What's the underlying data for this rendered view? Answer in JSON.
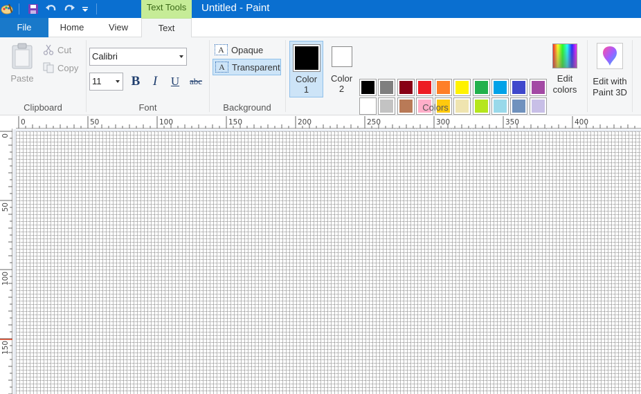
{
  "window": {
    "title": "Untitled - Paint",
    "context_tab_group": "Text Tools"
  },
  "tabs": {
    "file": "File",
    "home": "Home",
    "view": "View",
    "text": "Text"
  },
  "clipboard": {
    "paste": "Paste",
    "cut": "Cut",
    "copy": "Copy",
    "group_label": "Clipboard"
  },
  "font": {
    "family": "Calibri",
    "size": "11",
    "bold": "B",
    "italic": "I",
    "underline": "U",
    "strikethrough": "abc",
    "group_label": "Font"
  },
  "background": {
    "opaque": "Opaque",
    "transparent": "Transparent",
    "selected": "Transparent",
    "group_label": "Background"
  },
  "colors": {
    "color1_line1": "Color",
    "color1_line2": "1",
    "color1_value": "#000000",
    "color2_line1": "Color",
    "color2_line2": "2",
    "color2_value": "#ffffff",
    "edit_colors_line1": "Edit",
    "edit_colors_line2": "colors",
    "group_label": "Colors",
    "palette_row1": [
      "#000000",
      "#7f7f7f",
      "#880015",
      "#ed1c24",
      "#ff7f27",
      "#fff200",
      "#22b14c",
      "#00a2e8",
      "#3f48cc",
      "#a349a4"
    ],
    "palette_row2": [
      "#ffffff",
      "#c3c3c3",
      "#b97a57",
      "#ffaec9",
      "#ffc90e",
      "#efe4b0",
      "#b5e61d",
      "#99d9ea",
      "#7092be",
      "#c8bfe7"
    ]
  },
  "paint3d": {
    "line1": "Edit with",
    "line2": "Paint 3D"
  },
  "rulers": {
    "horizontal_labels": [
      "0",
      "50",
      "100",
      "150",
      "200",
      "250",
      "300",
      "350",
      "400"
    ],
    "vertical_labels": [
      "0",
      "50",
      "100",
      "150"
    ]
  }
}
